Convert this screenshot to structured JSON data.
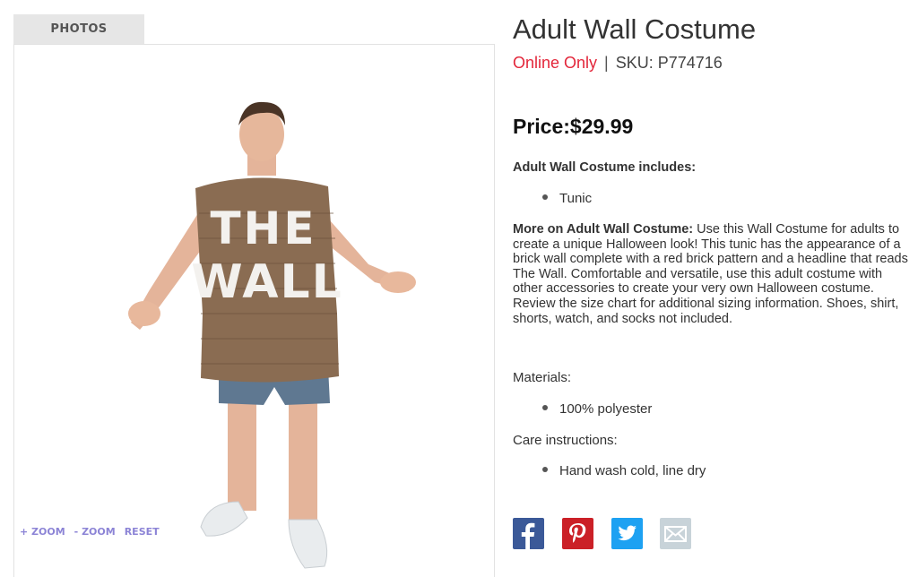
{
  "gallery": {
    "tab_label": "PHOTOS",
    "zoom_in_label": "+ ZOOM",
    "zoom_out_label": "- ZOOM",
    "reset_label": "RESET",
    "shirt_text_line1": "THE",
    "shirt_text_line2": "WALL"
  },
  "product": {
    "title": "Adult Wall Costume",
    "availability": "Online Only",
    "separator": "|",
    "sku": "SKU: P774716",
    "price": "Price:$29.99",
    "includes_heading": "Adult Wall Costume includes:",
    "includes_items": [
      "Tunic"
    ],
    "description_lead": "More on Adult Wall Costume:",
    "description_body": " Use this Wall Costume for adults to create a unique Halloween look! This tunic has the appearance of a brick wall complete with a red brick pattern and a headline that reads The Wall. Comfortable and versatile, use this adult costume with other accessories to create your very own Halloween costume. Review the size chart for additional sizing information. Shoes, shirt, shorts, watch, and socks not included.",
    "materials_heading": "Materials:",
    "materials_items": [
      "100% polyester"
    ],
    "care_heading": "Care instructions:",
    "care_items": [
      "Hand wash cold, line dry"
    ]
  },
  "colors": {
    "online_only": "#e3263a",
    "zoom_link": "#8c84d6",
    "facebook": "#3b5998",
    "pinterest": "#cb2027",
    "twitter": "#1da1f2",
    "email": "#c8d3d9"
  },
  "social": {
    "icons": [
      "facebook-icon",
      "pinterest-icon",
      "twitter-icon",
      "email-icon"
    ]
  }
}
